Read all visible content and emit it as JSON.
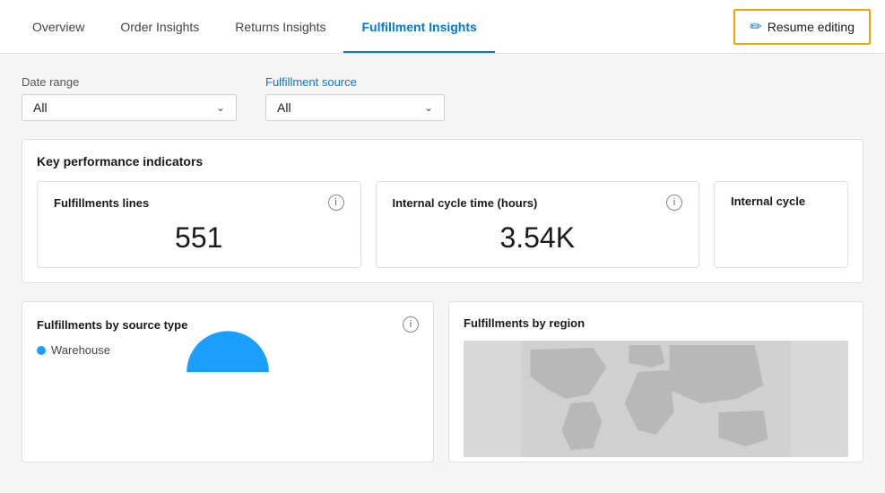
{
  "nav": {
    "tabs": [
      {
        "id": "overview",
        "label": "Overview",
        "active": false
      },
      {
        "id": "order-insights",
        "label": "Order Insights",
        "active": false
      },
      {
        "id": "returns-insights",
        "label": "Returns Insights",
        "active": false
      },
      {
        "id": "fulfillment-insights",
        "label": "Fulfillment Insights",
        "active": true
      }
    ],
    "resume_editing_label": "Resume editing"
  },
  "filters": {
    "date_range": {
      "label": "Date range",
      "value": "All"
    },
    "fulfillment_source": {
      "label": "Fulfillment source",
      "value": "All"
    }
  },
  "kpi": {
    "section_title": "Key performance indicators",
    "cards": [
      {
        "title": "Fulfillments lines",
        "value": "551"
      },
      {
        "title": "Internal cycle time (hours)",
        "value": "3.54K"
      },
      {
        "title": "Internal cycle",
        "value": ""
      }
    ]
  },
  "charts": {
    "fulfillments_by_source": {
      "title": "Fulfillments by source type",
      "legend": [
        {
          "label": "Warehouse",
          "color": "#1a9fff"
        }
      ]
    },
    "fulfillments_by_region": {
      "title": "Fulfillments by region"
    }
  }
}
